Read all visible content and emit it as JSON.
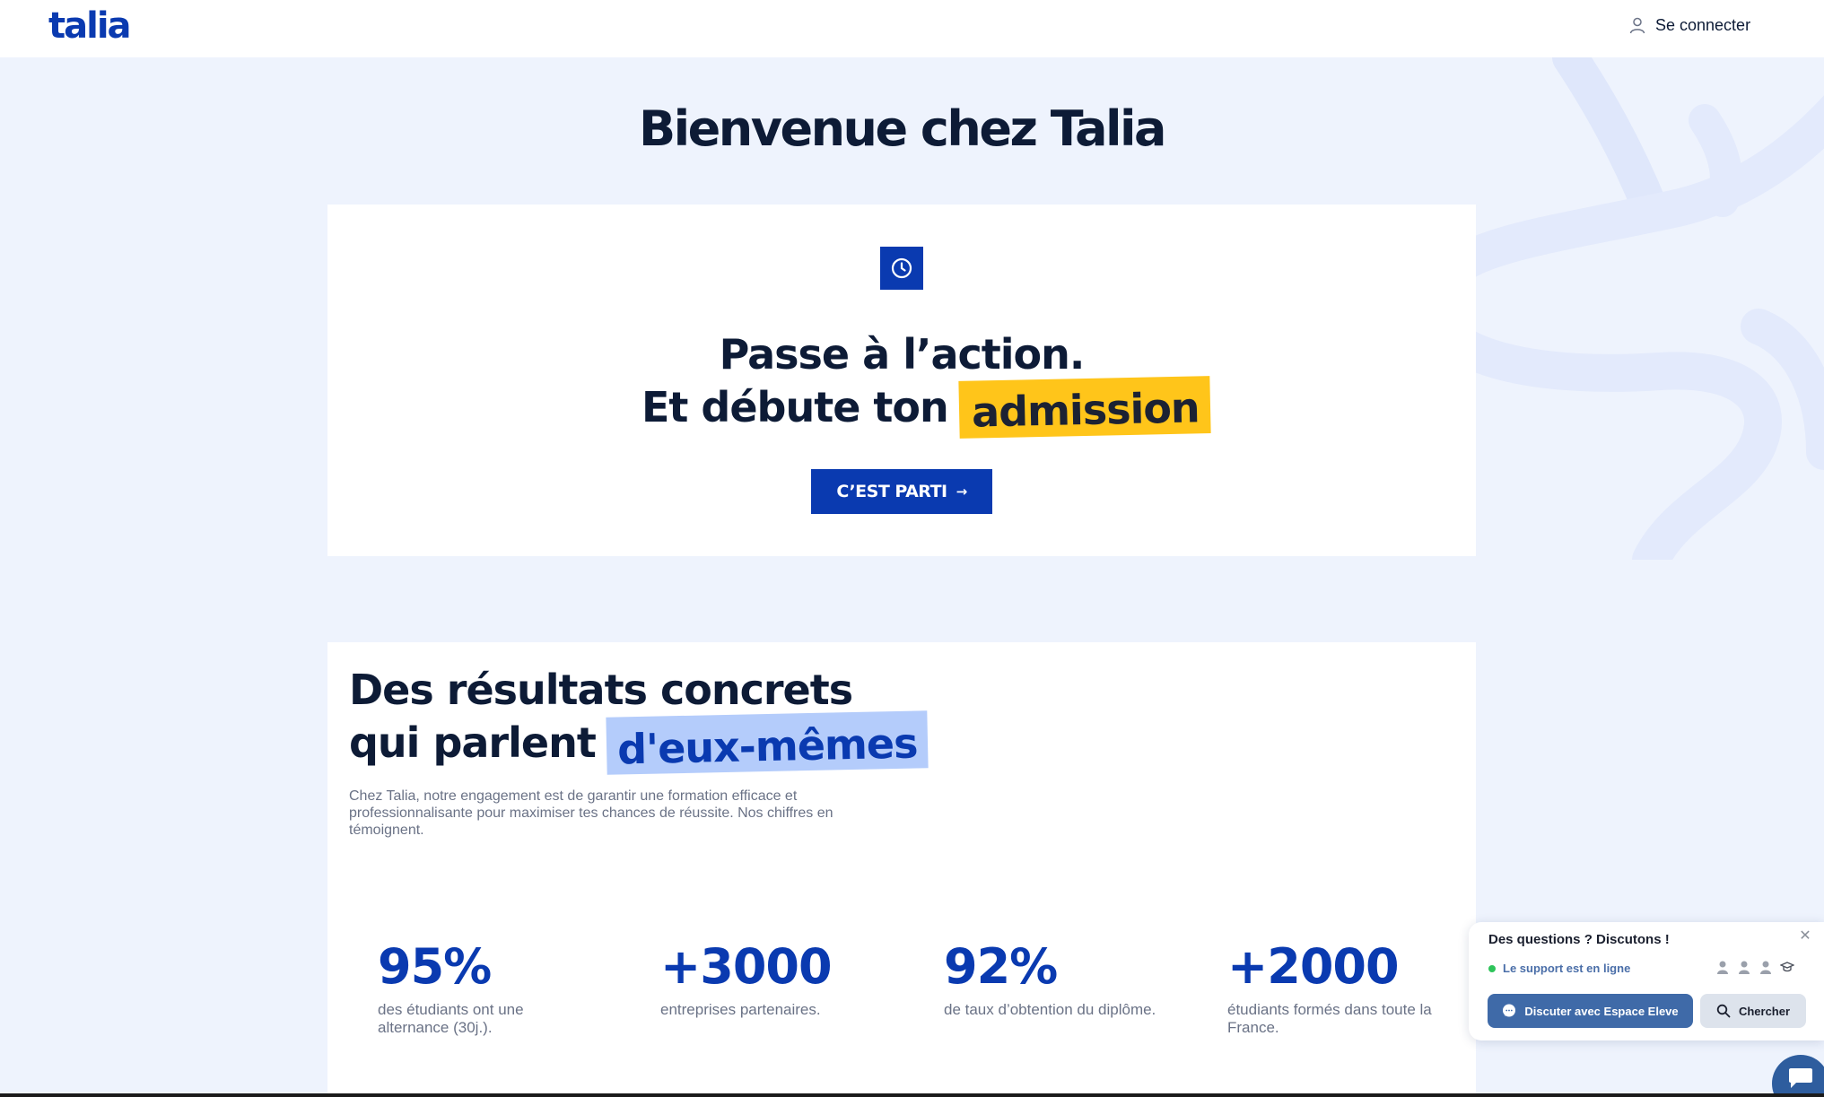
{
  "header": {
    "logo_text": "talia",
    "login_label": "Se connecter",
    "login_icon": "user-icon"
  },
  "page": {
    "title": "Bienvenue chez Talia"
  },
  "action_card": {
    "icon": "clock-icon",
    "line1": "Passe à l’action.",
    "line2_prefix": "Et débute ton",
    "line2_highlight": "admission",
    "cta_label": "C’EST PARTI",
    "cta_icon": "arrow-right-icon"
  },
  "results_card": {
    "title_line1": "Des résultats concrets",
    "title_line2_prefix": "qui parlent",
    "title_line2_highlight": "d'eux-mêmes",
    "description": "Chez Talia, notre engagement est de garantir une formation efficace et professionnalisante pour maximiser tes chances de réussite. Nos chiffres en témoignent.",
    "stats": [
      {
        "value": "95%",
        "label": "des étudiants ont une alternance (30j.)."
      },
      {
        "value": "+3000",
        "label": "entreprises partenaires."
      },
      {
        "value": "92%",
        "label": "de taux d’obtention du diplôme."
      },
      {
        "value": "+2000",
        "label": "étudiants formés dans toute la France."
      }
    ]
  },
  "chat_widget": {
    "title": "Des questions ? Discutons !",
    "close_icon": "close-icon",
    "status": "Le support est en ligne",
    "status_color": "#2ec45a",
    "primary_button": "Discuter avec Espace Eleve",
    "search_button": "Chercher"
  },
  "colors": {
    "brand_blue": "#0a3ab0",
    "highlight_yellow": "#ffc51a",
    "highlight_blue": "#b4ccfb",
    "page_background": "#eef3fd"
  }
}
